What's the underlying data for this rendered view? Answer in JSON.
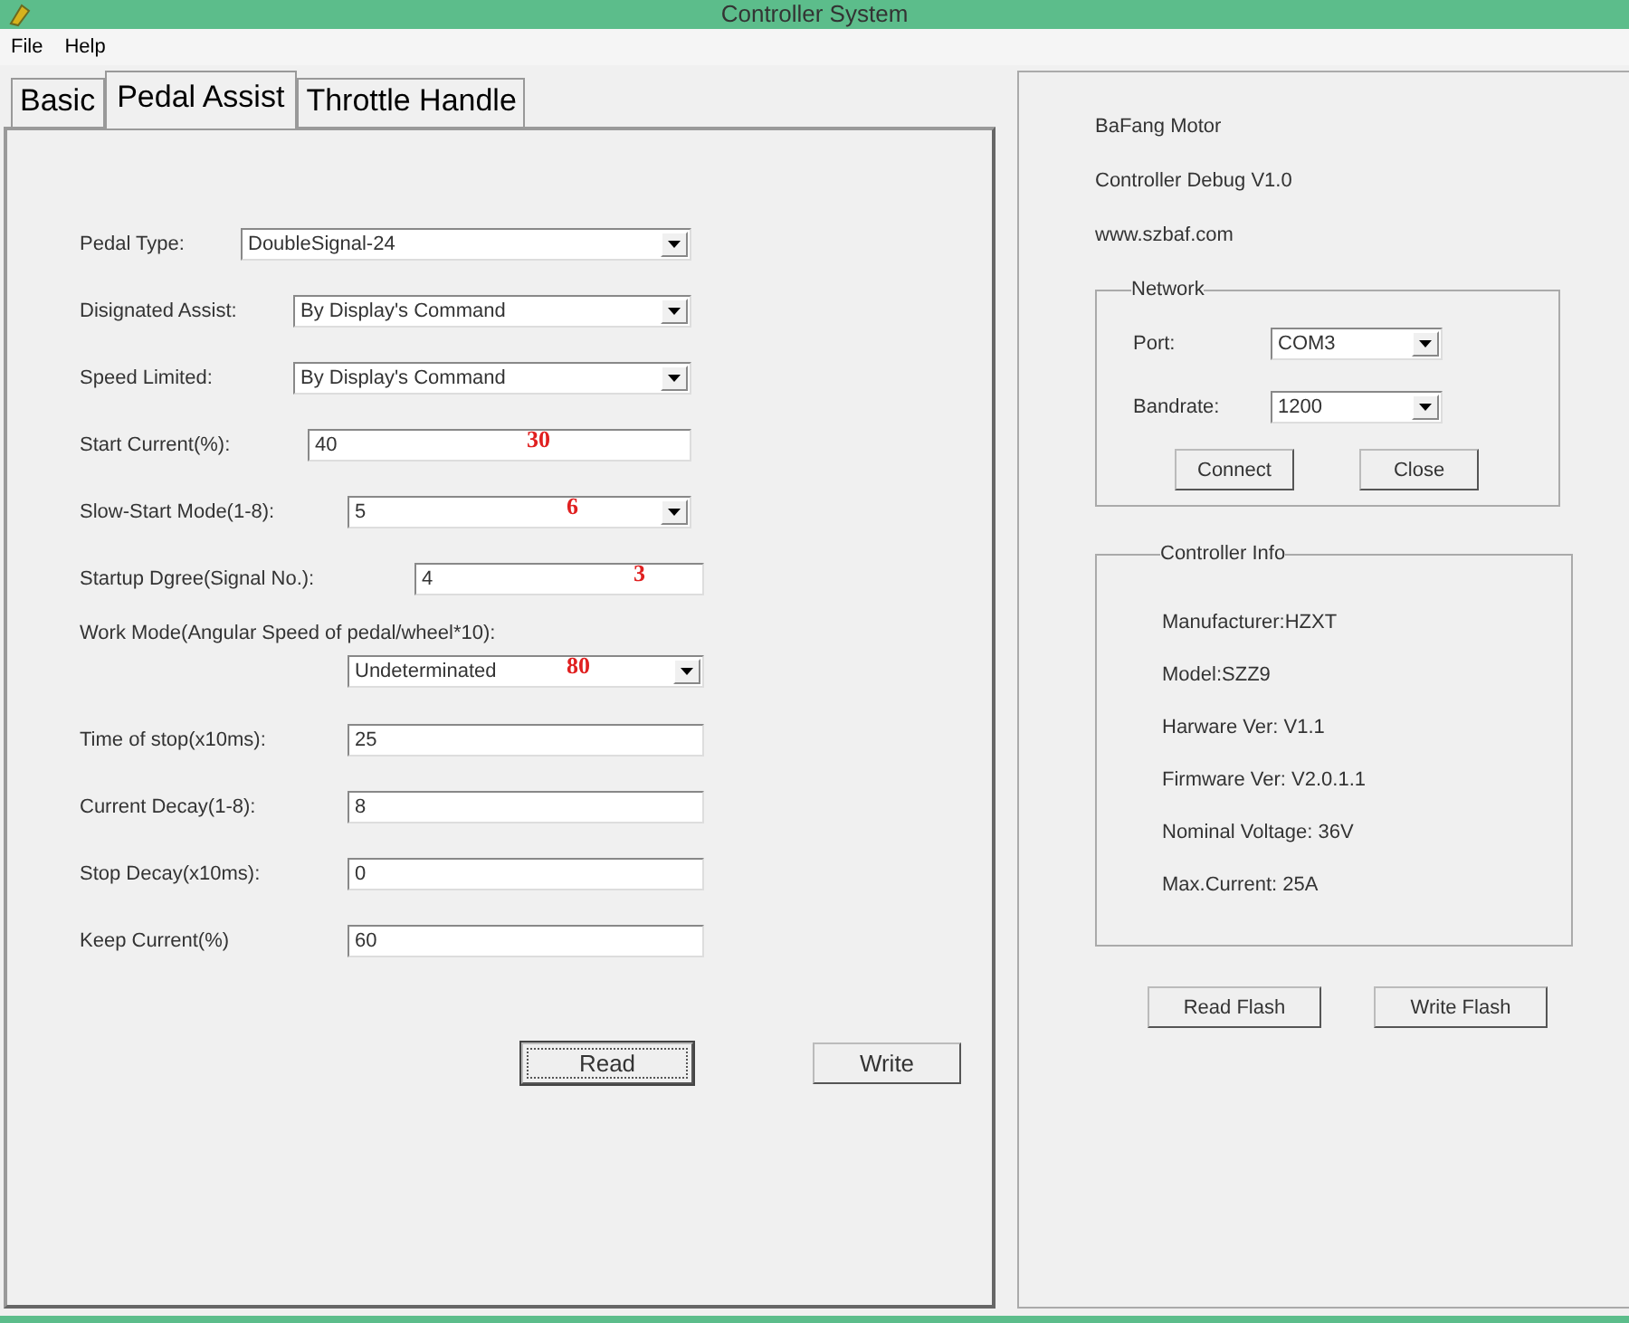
{
  "window": {
    "title": "Controller System"
  },
  "menu": [
    "File",
    "Help"
  ],
  "tabs": [
    {
      "label": "Basic",
      "selected": false
    },
    {
      "label": "Pedal Assist",
      "selected": true
    },
    {
      "label": "Throttle Handle",
      "selected": false
    }
  ],
  "fields": [
    {
      "label": "Pedal Type:",
      "kind": "select",
      "value": "DoubleSignal-24"
    },
    {
      "label": "Disignated Assist:",
      "kind": "select",
      "value": "By Display's Command"
    },
    {
      "label": "Speed Limited:",
      "kind": "select",
      "value": "By Display's Command"
    },
    {
      "label": "Start Current(%):",
      "kind": "text",
      "value": "40",
      "note": "30"
    },
    {
      "label": "Slow-Start Mode(1-8):",
      "kind": "select",
      "value": "5",
      "note": "6"
    },
    {
      "label": "Startup Dgree(Signal No.):",
      "kind": "text",
      "value": "4",
      "note": "3"
    },
    {
      "label": "Work Mode(Angular Speed of pedal/wheel*10):",
      "kind": "select_below",
      "value": "Undeterminated",
      "note": "80"
    },
    {
      "label": "Time of stop(x10ms):",
      "kind": "text",
      "value": "25"
    },
    {
      "label": "Current Decay(1-8):",
      "kind": "text",
      "value": "8"
    },
    {
      "label": "Stop Decay(x10ms):",
      "kind": "text",
      "value": "0"
    },
    {
      "label": "Keep Current(%)",
      "kind": "text",
      "value": "60"
    }
  ],
  "buttons": [
    {
      "label": "Read",
      "focused": true
    },
    {
      "label": "Write",
      "focused": false
    }
  ],
  "about": [
    "BaFang Motor",
    "Controller Debug V1.0",
    "www.szbaf.com"
  ],
  "network": {
    "title": "Network",
    "fields": [
      {
        "label": "Port:",
        "value": "COM3"
      },
      {
        "label": "Bandrate:",
        "value": "1200"
      }
    ],
    "buttons": [
      "Connect",
      "Close"
    ]
  },
  "controller_info": {
    "title": "Controller Info",
    "lines": [
      "Manufacturer:HZXT",
      "Model:SZZ9",
      "Harware Ver: V1.1",
      "Firmware Ver: V2.0.1.1",
      "Nominal Voltage: 36V",
      "Max.Current: 25A"
    ]
  },
  "flash_buttons": [
    "Read Flash",
    "Write Flash"
  ]
}
